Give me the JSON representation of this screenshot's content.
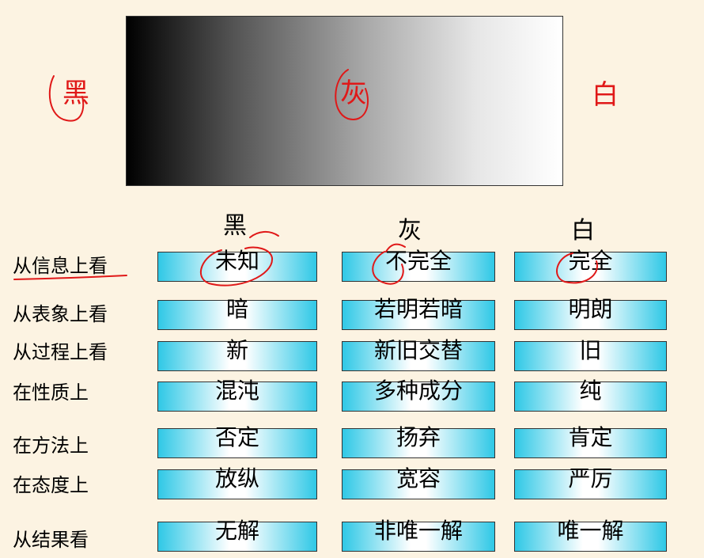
{
  "top": {
    "left_label": "黑",
    "middle_label": "灰",
    "right_label": "白"
  },
  "table": {
    "columns": [
      "黑",
      "灰",
      "白"
    ],
    "rows": [
      {
        "label": "从信息上看",
        "cells": [
          "未知",
          "不完全",
          "完全"
        ]
      },
      {
        "label": "从表象上看",
        "cells": [
          "暗",
          "若明若暗",
          "明朗"
        ]
      },
      {
        "label": "从过程上看",
        "cells": [
          "新",
          "新旧交替",
          "旧"
        ]
      },
      {
        "label": "在性质上",
        "cells": [
          "混沌",
          "多种成分",
          "纯"
        ]
      },
      {
        "label": "在方法上",
        "cells": [
          "否定",
          "扬弃",
          "肯定"
        ]
      },
      {
        "label": "在态度上",
        "cells": [
          "放纵",
          "宽容",
          "严厉"
        ]
      },
      {
        "label": "从结果看",
        "cells": [
          "无解",
          "非唯一解",
          "唯一解"
        ]
      }
    ]
  },
  "colors": {
    "annotation_red": "#e01818",
    "cell_cyan": "#2fc8e6",
    "background": "#fcf3e2"
  }
}
